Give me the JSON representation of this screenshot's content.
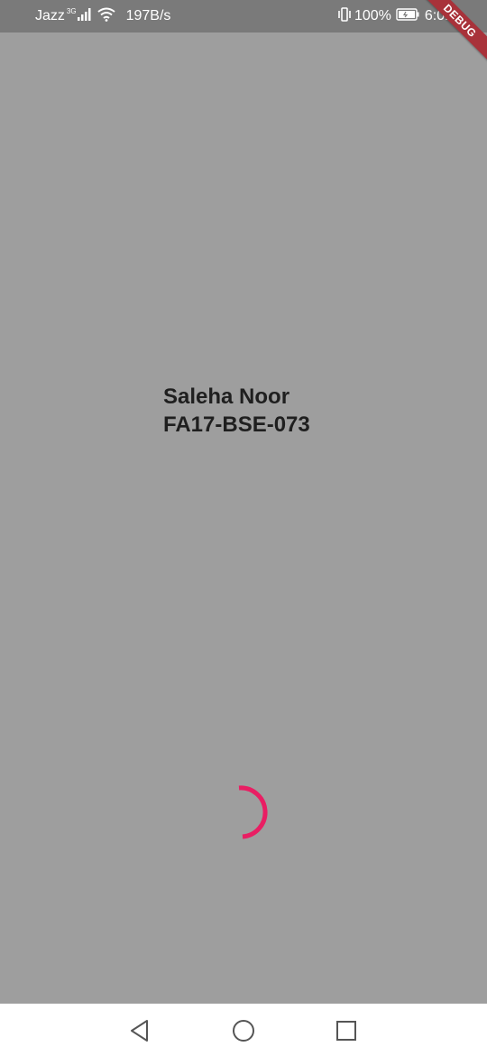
{
  "status_bar": {
    "carrier": "Jazz",
    "network_type": "3G",
    "speed": "197B/s",
    "battery_percent": "100%",
    "time": "6:01",
    "icons": [
      "signal-icon",
      "wifi-icon",
      "vibrate-icon",
      "battery-icon"
    ]
  },
  "debug_banner": "DEBUG",
  "main": {
    "name": "Saleha Noor",
    "id": "FA17-BSE-073"
  },
  "colors": {
    "background": "#9e9e9e",
    "status_bar": "#7a7a7a",
    "spinner": "#e91e63",
    "text": "#1f1f1f",
    "debug_banner": "#a8323a"
  },
  "nav_bar": {
    "buttons": [
      "back-icon",
      "home-icon",
      "recents-icon"
    ]
  }
}
